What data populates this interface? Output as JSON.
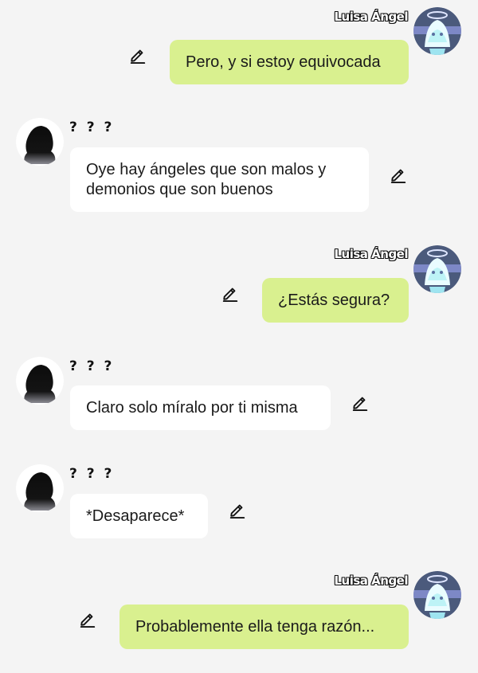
{
  "chat": {
    "messages": [
      {
        "sender": "Luisa Ángel",
        "text": "Pero, y si estoy equivocada",
        "side": "right"
      },
      {
        "sender": "? ? ?",
        "text": "Oye hay ángeles que son malos y demonios que son buenos",
        "side": "left"
      },
      {
        "sender": "Luisa Ángel",
        "text": "¿Estás segura?",
        "side": "right"
      },
      {
        "sender": "? ? ?",
        "text": "Claro solo míralo por ti misma",
        "side": "left"
      },
      {
        "sender": "? ? ?",
        "text": "*Desaparece*",
        "side": "left"
      },
      {
        "sender": "Luisa Ángel",
        "text": "Probablemente ella tenga razón...",
        "side": "right"
      }
    ]
  },
  "icons": {
    "edit": "pencil-icon",
    "angel_avatar": "angel-avatar",
    "silhouette_avatar": "silhouette-avatar"
  },
  "colors": {
    "background": "#f4f4f4",
    "mine_bubble": "#d9f08f",
    "theirs_bubble": "#ffffff",
    "text": "#1b1b1b"
  }
}
